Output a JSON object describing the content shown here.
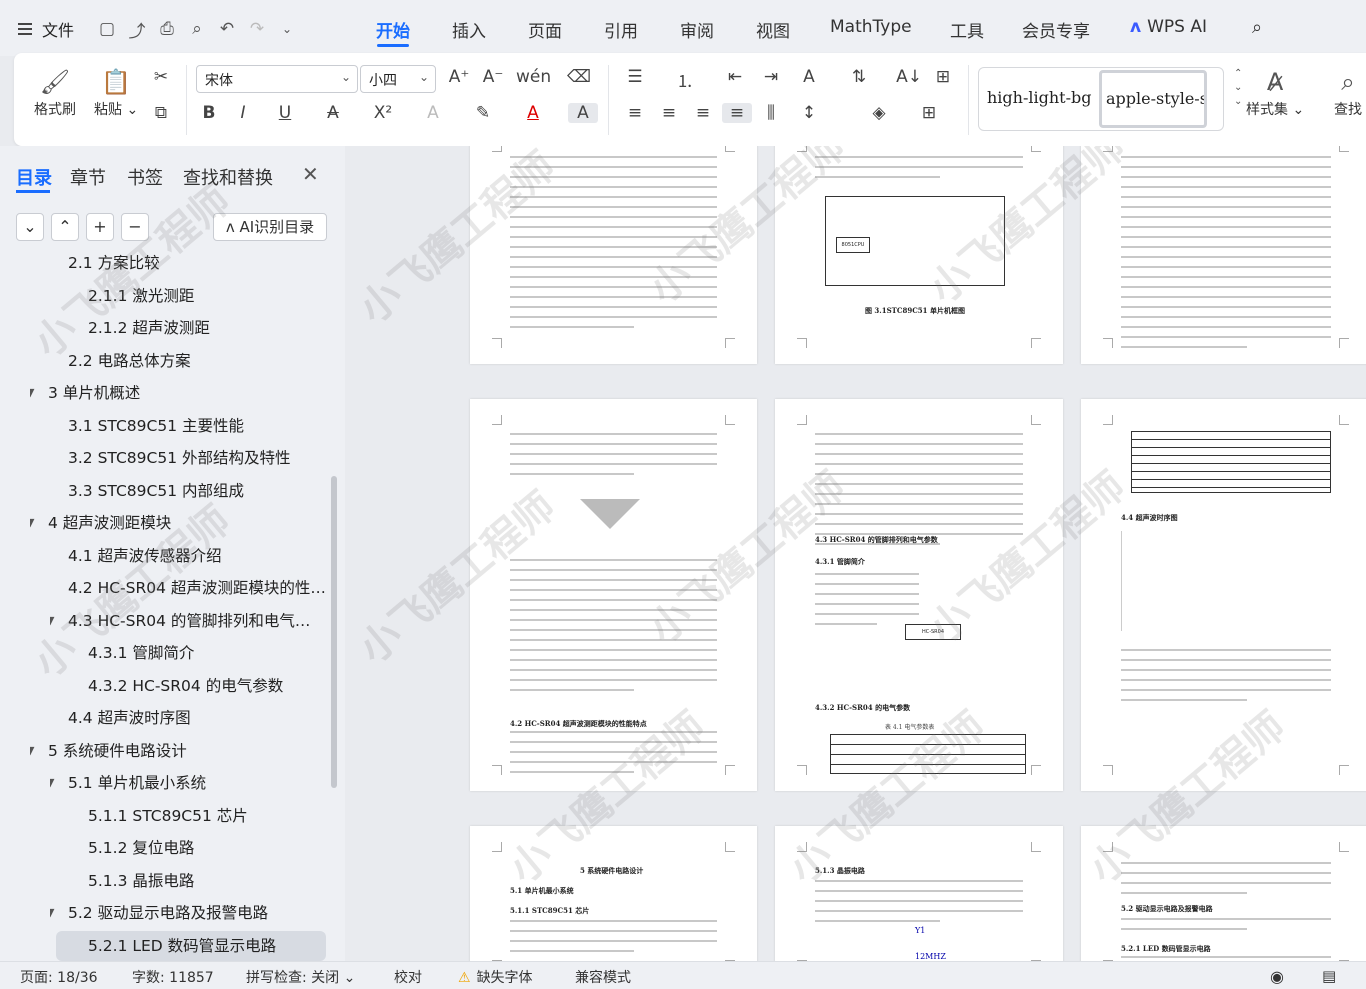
{
  "menubar": {
    "file_label": "文件",
    "tabs": [
      "开始",
      "插入",
      "页面",
      "引用",
      "审阅",
      "视图",
      "MathType",
      "工具",
      "会员专享",
      "WPS AI"
    ],
    "active_tab": "开始"
  },
  "ribbon": {
    "format_painter": "格式刷",
    "paste": "粘贴",
    "font_name": "宋体",
    "font_size": "小四",
    "styles": [
      "high-light-bg",
      "apple-style-spa"
    ],
    "style_set": "样式集",
    "find": "查找"
  },
  "nav": {
    "tabs": [
      "目录",
      "章节",
      "书签",
      "查找和替换"
    ],
    "active_tab": "目录",
    "ai_button": "AI识别目录",
    "toc": [
      {
        "label": "2.1 方案比较",
        "level": 1
      },
      {
        "label": "2.1.1  激光测距",
        "level": 2
      },
      {
        "label": "2.1.2  超声波测距",
        "level": 2
      },
      {
        "label": "2.2 电路总体方案",
        "level": 1
      },
      {
        "label": "3 单片机概述",
        "level": 0
      },
      {
        "label": "3.1 STC89C51 主要性能",
        "level": 1
      },
      {
        "label": "3.2 STC89C51 外部结构及特性",
        "level": 1
      },
      {
        "label": "3.3 STC89C51 内部组成",
        "level": 1
      },
      {
        "label": "4  超声波测距模块",
        "level": 0
      },
      {
        "label": "4.1  超声波传感器介绍",
        "level": 1
      },
      {
        "label": "4.2 HC-SR04 超声波测距模块的性…",
        "level": 1
      },
      {
        "label": "4.3 HC-SR04 的管脚排列和电气参…",
        "level": 1
      },
      {
        "label": "4.3.1  管脚简介",
        "level": 2
      },
      {
        "label": "4.3.2 HC-SR04 的电气参数",
        "level": 2
      },
      {
        "label": "4.4 超声波时序图",
        "level": 1
      },
      {
        "label": "5 系统硬件电路设计",
        "level": 0
      },
      {
        "label": "5.1 单片机最小系统",
        "level": 1
      },
      {
        "label": "5.1.1 STC89C51 芯片",
        "level": 2
      },
      {
        "label": "5.1.2  复位电路",
        "level": 2
      },
      {
        "label": "5.1.3  晶振电路",
        "level": 2
      },
      {
        "label": "5.2  驱动显示电路及报警电路",
        "level": 1
      },
      {
        "label": "5.2.1   LED 数码管显示电路",
        "level": 2
      }
    ]
  },
  "document": {
    "watermark": "小飞鹰工程师",
    "headings": [
      "图 3.1STC89C51 单片机框图",
      "4.2 HC-SR04 超声波测距模块的性能特点",
      "4.3 HC-SR04 的管脚排列和电气参数",
      "4.3.1  管脚简介",
      "4.3.2 HC-SR04 的电气参数",
      "4.4 超声波时序图",
      "5 系统硬件电路设计",
      "5.1 单片机最小系统",
      "5.1.1 STC89C51 芯片",
      "5.1.3  晶振电路",
      "5.2  驱动显示电路及报警电路",
      "5.2.1   LED 数码管显示电路"
    ],
    "crystal_label": "Y1",
    "crystal_freq": "12MHZ",
    "chip_label": "HC-SR04",
    "cpu_label": "8051CPU",
    "table_caption": "表 4.1  电气参数表"
  },
  "statusbar": {
    "page": "页面: 18/36",
    "words": "字数: 11857",
    "spell": "拼写检查: 关闭",
    "proof": "校对",
    "missing_font": "缺失字体",
    "compat": "兼容模式"
  }
}
